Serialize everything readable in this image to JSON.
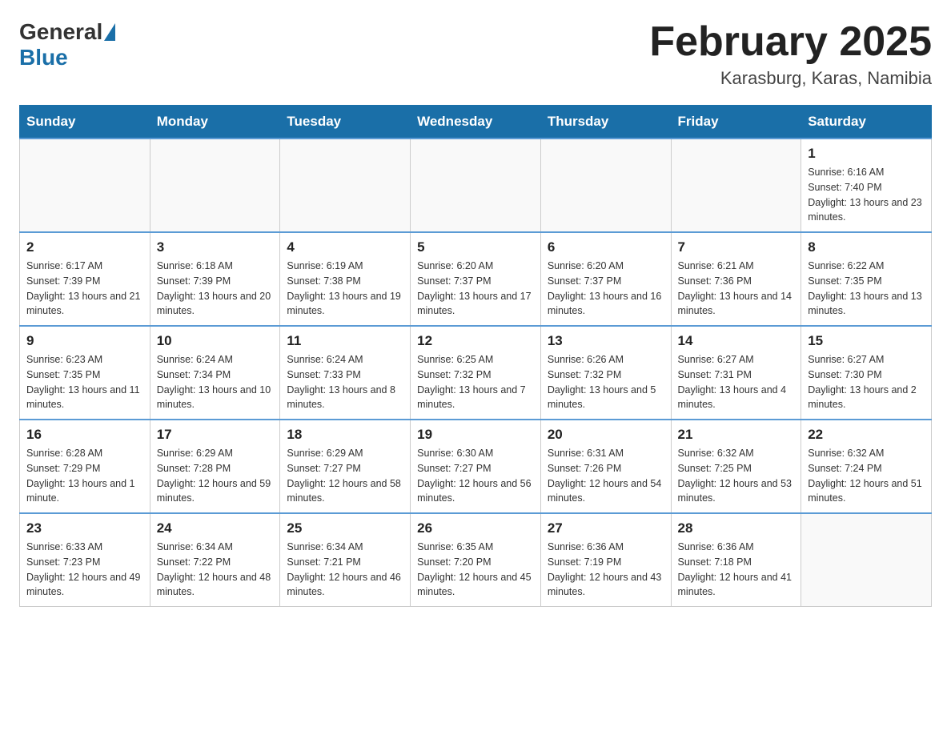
{
  "header": {
    "logo_general": "General",
    "logo_blue": "Blue",
    "title": "February 2025",
    "subtitle": "Karasburg, Karas, Namibia"
  },
  "weekdays": [
    "Sunday",
    "Monday",
    "Tuesday",
    "Wednesday",
    "Thursday",
    "Friday",
    "Saturday"
  ],
  "weeks": [
    [
      {
        "day": "",
        "info": ""
      },
      {
        "day": "",
        "info": ""
      },
      {
        "day": "",
        "info": ""
      },
      {
        "day": "",
        "info": ""
      },
      {
        "day": "",
        "info": ""
      },
      {
        "day": "",
        "info": ""
      },
      {
        "day": "1",
        "info": "Sunrise: 6:16 AM\nSunset: 7:40 PM\nDaylight: 13 hours and 23 minutes."
      }
    ],
    [
      {
        "day": "2",
        "info": "Sunrise: 6:17 AM\nSunset: 7:39 PM\nDaylight: 13 hours and 21 minutes."
      },
      {
        "day": "3",
        "info": "Sunrise: 6:18 AM\nSunset: 7:39 PM\nDaylight: 13 hours and 20 minutes."
      },
      {
        "day": "4",
        "info": "Sunrise: 6:19 AM\nSunset: 7:38 PM\nDaylight: 13 hours and 19 minutes."
      },
      {
        "day": "5",
        "info": "Sunrise: 6:20 AM\nSunset: 7:37 PM\nDaylight: 13 hours and 17 minutes."
      },
      {
        "day": "6",
        "info": "Sunrise: 6:20 AM\nSunset: 7:37 PM\nDaylight: 13 hours and 16 minutes."
      },
      {
        "day": "7",
        "info": "Sunrise: 6:21 AM\nSunset: 7:36 PM\nDaylight: 13 hours and 14 minutes."
      },
      {
        "day": "8",
        "info": "Sunrise: 6:22 AM\nSunset: 7:35 PM\nDaylight: 13 hours and 13 minutes."
      }
    ],
    [
      {
        "day": "9",
        "info": "Sunrise: 6:23 AM\nSunset: 7:35 PM\nDaylight: 13 hours and 11 minutes."
      },
      {
        "day": "10",
        "info": "Sunrise: 6:24 AM\nSunset: 7:34 PM\nDaylight: 13 hours and 10 minutes."
      },
      {
        "day": "11",
        "info": "Sunrise: 6:24 AM\nSunset: 7:33 PM\nDaylight: 13 hours and 8 minutes."
      },
      {
        "day": "12",
        "info": "Sunrise: 6:25 AM\nSunset: 7:32 PM\nDaylight: 13 hours and 7 minutes."
      },
      {
        "day": "13",
        "info": "Sunrise: 6:26 AM\nSunset: 7:32 PM\nDaylight: 13 hours and 5 minutes."
      },
      {
        "day": "14",
        "info": "Sunrise: 6:27 AM\nSunset: 7:31 PM\nDaylight: 13 hours and 4 minutes."
      },
      {
        "day": "15",
        "info": "Sunrise: 6:27 AM\nSunset: 7:30 PM\nDaylight: 13 hours and 2 minutes."
      }
    ],
    [
      {
        "day": "16",
        "info": "Sunrise: 6:28 AM\nSunset: 7:29 PM\nDaylight: 13 hours and 1 minute."
      },
      {
        "day": "17",
        "info": "Sunrise: 6:29 AM\nSunset: 7:28 PM\nDaylight: 12 hours and 59 minutes."
      },
      {
        "day": "18",
        "info": "Sunrise: 6:29 AM\nSunset: 7:27 PM\nDaylight: 12 hours and 58 minutes."
      },
      {
        "day": "19",
        "info": "Sunrise: 6:30 AM\nSunset: 7:27 PM\nDaylight: 12 hours and 56 minutes."
      },
      {
        "day": "20",
        "info": "Sunrise: 6:31 AM\nSunset: 7:26 PM\nDaylight: 12 hours and 54 minutes."
      },
      {
        "day": "21",
        "info": "Sunrise: 6:32 AM\nSunset: 7:25 PM\nDaylight: 12 hours and 53 minutes."
      },
      {
        "day": "22",
        "info": "Sunrise: 6:32 AM\nSunset: 7:24 PM\nDaylight: 12 hours and 51 minutes."
      }
    ],
    [
      {
        "day": "23",
        "info": "Sunrise: 6:33 AM\nSunset: 7:23 PM\nDaylight: 12 hours and 49 minutes."
      },
      {
        "day": "24",
        "info": "Sunrise: 6:34 AM\nSunset: 7:22 PM\nDaylight: 12 hours and 48 minutes."
      },
      {
        "day": "25",
        "info": "Sunrise: 6:34 AM\nSunset: 7:21 PM\nDaylight: 12 hours and 46 minutes."
      },
      {
        "day": "26",
        "info": "Sunrise: 6:35 AM\nSunset: 7:20 PM\nDaylight: 12 hours and 45 minutes."
      },
      {
        "day": "27",
        "info": "Sunrise: 6:36 AM\nSunset: 7:19 PM\nDaylight: 12 hours and 43 minutes."
      },
      {
        "day": "28",
        "info": "Sunrise: 6:36 AM\nSunset: 7:18 PM\nDaylight: 12 hours and 41 minutes."
      },
      {
        "day": "",
        "info": ""
      }
    ]
  ]
}
